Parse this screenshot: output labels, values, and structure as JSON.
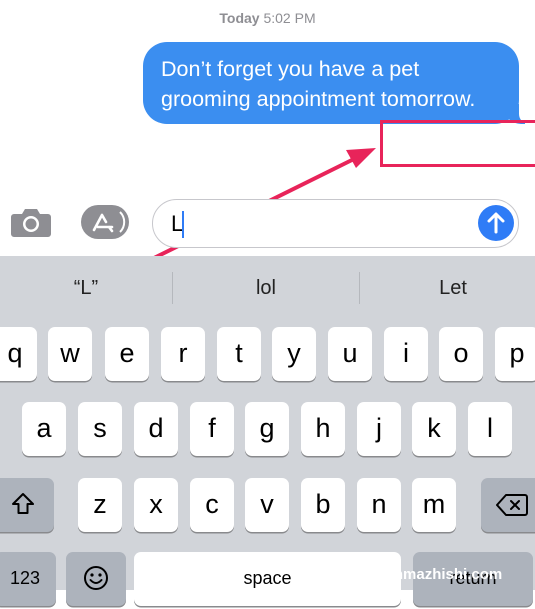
{
  "conversation": {
    "timestamp_day": "Today",
    "timestamp_time": "5:02 PM",
    "message_line1": "Don’t forget you have a pet",
    "message_line2": "grooming appointment tomorrow."
  },
  "compose": {
    "input_value": "L",
    "camera_icon": "camera-icon",
    "appstore_icon": "app-store-icon",
    "send_icon": "arrow-up-send-icon"
  },
  "keyboard": {
    "suggestions": [
      "“L”",
      "lol",
      "Let"
    ],
    "row1": [
      "q",
      "w",
      "e",
      "r",
      "t",
      "y",
      "u",
      "i",
      "o",
      "p"
    ],
    "row2": [
      "a",
      "s",
      "d",
      "f",
      "g",
      "h",
      "j",
      "k",
      "l"
    ],
    "row3": [
      "z",
      "x",
      "c",
      "v",
      "b",
      "n",
      "m"
    ],
    "numbers_label": "123",
    "space_label": "space",
    "return_label": "return"
  },
  "annotation": {
    "color": "#e8245a"
  },
  "watermark": "shenmazhishi.com",
  "colors": {
    "bubble": "#3b8ef0",
    "send": "#2f7cf6",
    "keyboard_bg": "#d1d4d9"
  }
}
